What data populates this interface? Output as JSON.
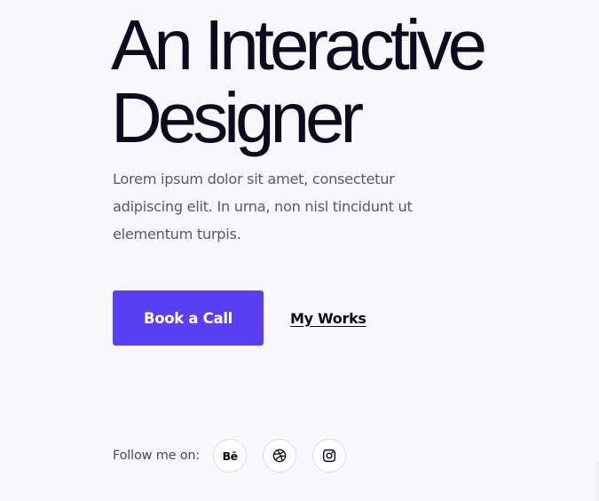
{
  "hero": {
    "title_line1": "An Interactive",
    "title_line2": "Designer",
    "description": "Lorem ipsum dolor sit amet, consectetur adipiscing elit. In urna, non nisl tincidunt ut elementum turpis."
  },
  "cta": {
    "primary_label": "Book a Call",
    "secondary_label": "My Works",
    "primary_color": "#5a3ef3"
  },
  "social": {
    "follow_label": "Follow me on:",
    "links": [
      {
        "icon": "behance-icon",
        "glyph": "Bē"
      },
      {
        "icon": "dribbble-icon"
      },
      {
        "icon": "instagram-icon"
      }
    ]
  }
}
